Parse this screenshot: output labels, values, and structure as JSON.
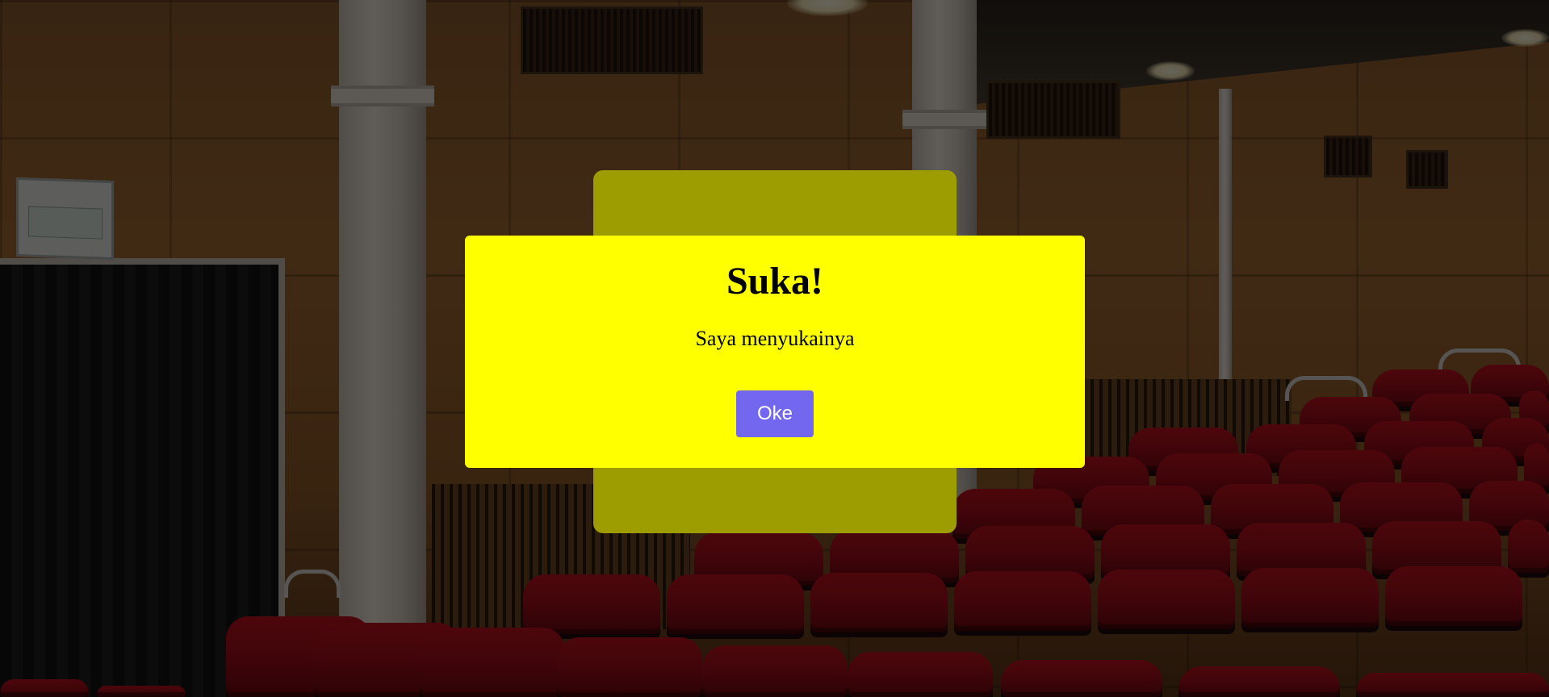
{
  "background": {
    "description_icon": "theater-hall-image"
  },
  "modal": {
    "title": "Suka!",
    "message": "Saya menyukainya",
    "confirm_label": "Oke"
  },
  "colors": {
    "dialog_background": "#ffff00",
    "backcard": "#9d9c00",
    "confirm_button": "#7367f0",
    "overlay": "rgba(0,0,0,0.60)"
  }
}
